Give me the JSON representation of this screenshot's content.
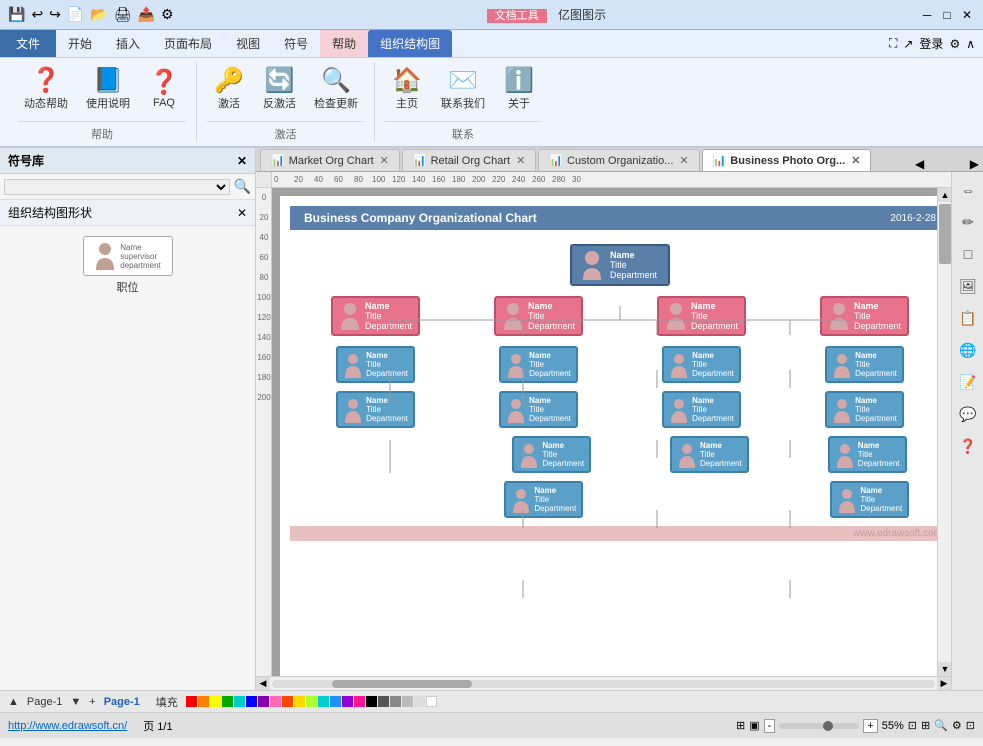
{
  "titleBar": {
    "title": "亿图图示",
    "toolsTab": "文档工具",
    "windowControls": [
      "_",
      "□",
      "×"
    ]
  },
  "menuBar": {
    "items": [
      "文件",
      "开始",
      "插入",
      "页面布局",
      "视图",
      "符号",
      "帮助",
      "组织结构图"
    ],
    "activeItem": "组织结构图",
    "highlightedItem": "帮助"
  },
  "ribbon": {
    "groups": [
      {
        "title": "帮助",
        "buttons": [
          {
            "icon": "❓",
            "label": "动态帮助"
          },
          {
            "icon": "📖",
            "label": "使用说明"
          },
          {
            "icon": "❓",
            "label": "FAQ"
          }
        ]
      },
      {
        "title": "激活",
        "buttons": [
          {
            "icon": "🔑",
            "label": "激活"
          },
          {
            "icon": "🔄",
            "label": "反激活"
          },
          {
            "icon": "🔍",
            "label": "检查更新"
          }
        ]
      },
      {
        "title": "联系",
        "buttons": [
          {
            "icon": "🏠",
            "label": "主页"
          },
          {
            "icon": "✉️",
            "label": "联系我们"
          },
          {
            "icon": "ℹ️",
            "label": "关于"
          }
        ]
      }
    ],
    "rightControls": [
      "登录",
      "⚙",
      "∧"
    ]
  },
  "symbolPanel": {
    "title": "符号库",
    "searchPlaceholder": "",
    "sectionTitle": "组织结构图形状",
    "shapes": [
      {
        "label": "职位",
        "type": "person-card"
      }
    ]
  },
  "tabs": [
    {
      "label": "Market Org Chart",
      "active": false,
      "icon": "📊"
    },
    {
      "label": "Retail Org Chart",
      "active": false,
      "icon": "📊"
    },
    {
      "label": "Custom Organizatio...",
      "active": false,
      "icon": "📊"
    },
    {
      "label": "Business Photo Org...",
      "active": true,
      "icon": "📊"
    }
  ],
  "canvas": {
    "chartTitle": "Business Company Organizational Chart",
    "chartDate": "2016-2-28",
    "topNode": {
      "name": "Name",
      "title": "Title",
      "department": "Department"
    },
    "level2Nodes": [
      {
        "name": "Name",
        "title": "Title",
        "department": "Department"
      },
      {
        "name": "Name",
        "title": "Title",
        "department": "Department"
      },
      {
        "name": "Name",
        "title": "Title",
        "department": "Department"
      },
      {
        "name": "Name",
        "title": "Title",
        "department": "Department"
      }
    ],
    "level3RowA": [
      {
        "name": "Name",
        "title": "Title",
        "department": "Department"
      },
      {
        "name": "Name",
        "title": "Title",
        "department": "Department"
      },
      {
        "name": "Name",
        "title": "Title",
        "department": "Department"
      },
      {
        "name": "Name",
        "title": "Title",
        "department": "Department"
      }
    ],
    "level3RowB": [
      {
        "name": "Name",
        "title": "Title",
        "department": "Department"
      },
      {
        "name": "Name",
        "title": "Title",
        "department": "Department"
      },
      {
        "name": "Name",
        "title": "Title",
        "department": "Department"
      },
      {
        "name": "Name",
        "title": "Title",
        "department": "Department"
      }
    ],
    "level3RowC": [
      {
        "name": "Name",
        "title": "Title",
        "department": "Department"
      },
      {
        "name": "Name",
        "title": "Title",
        "department": "Department"
      },
      {
        "name": "Name",
        "title": "Title",
        "department": "Department"
      }
    ],
    "level3RowD": [
      {
        "name": "Name",
        "title": "Title",
        "department": "Department"
      },
      {
        "name": "Name",
        "title": "Title",
        "department": "Department"
      }
    ],
    "watermark": "www.edrawsoft.com"
  },
  "rightToolbar": {
    "buttons": [
      "↕",
      "✏",
      "□",
      "🖼",
      "📋",
      "🌐",
      "📝",
      "💬",
      "❓"
    ]
  },
  "statusBar": {
    "pageNav": "Page-1",
    "addPage": "+",
    "pageTab": "Page-1",
    "fill": "填充",
    "colors": [
      "#FF0000",
      "#FF7F00",
      "#FFFF00",
      "#00FF00",
      "#00FFFF",
      "#0000FF",
      "#8B00FF",
      "#FF69B4",
      "#FF4500",
      "#FFD700",
      "#ADFF2F",
      "#00CED1",
      "#1E90FF",
      "#9400D3",
      "#FF1493",
      "#000000",
      "#333333",
      "#666666",
      "#999999",
      "#CCCCCC",
      "#FFFFFF"
    ]
  },
  "footer": {
    "url": "http://www.edrawsoft.cn/",
    "pageInfo": "页 1/1",
    "zoomLevel": "55%",
    "zoomMinus": "-",
    "zoomPlus": "+"
  }
}
